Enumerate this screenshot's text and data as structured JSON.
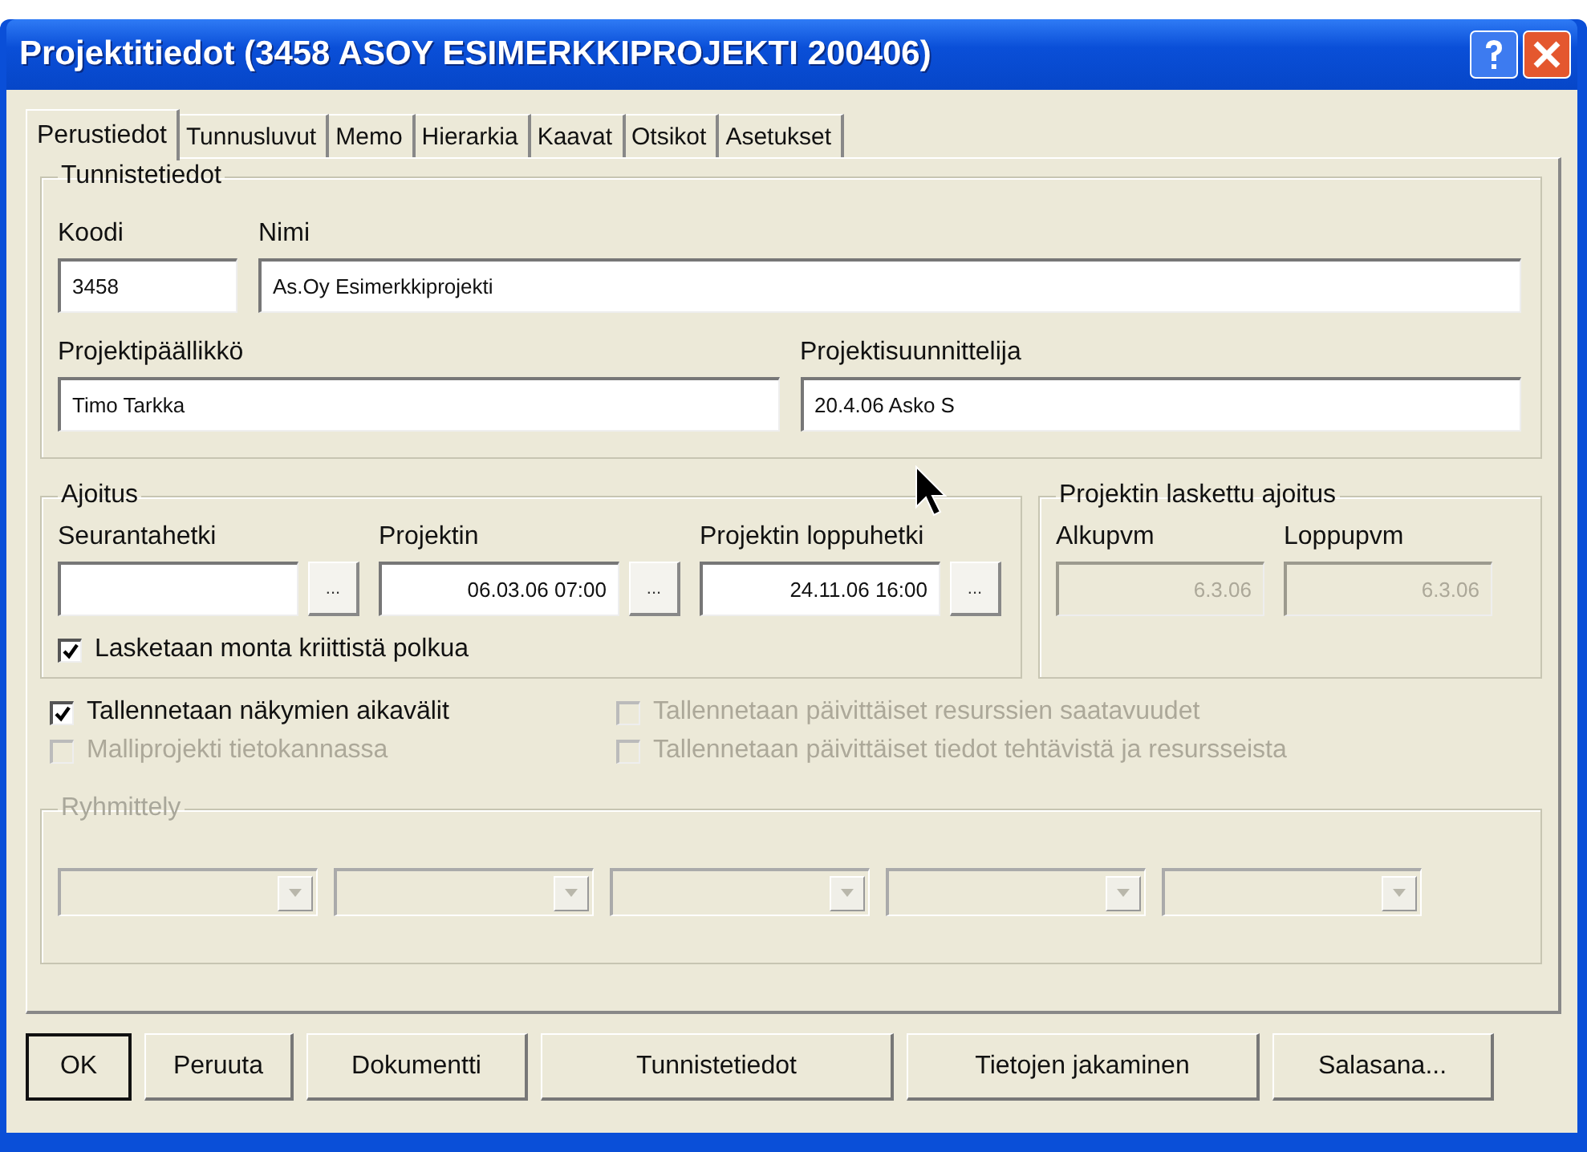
{
  "window": {
    "title": "Projektitiedot (3458 ASOY ESIMERKKIPROJEKTI 200406)"
  },
  "tabs": [
    {
      "label": "Perustiedot",
      "selected": true
    },
    {
      "label": "Tunnusluvut",
      "selected": false
    },
    {
      "label": "Memo",
      "selected": false
    },
    {
      "label": "Hierarkia",
      "selected": false
    },
    {
      "label": "Kaavat",
      "selected": false
    },
    {
      "label": "Otsikot",
      "selected": false
    },
    {
      "label": "Asetukset",
      "selected": false
    }
  ],
  "identification": {
    "legend": "Tunnistetiedot",
    "fields": [
      {
        "label": "Koodi",
        "value": "3458"
      },
      {
        "label": "Nimi",
        "value": "As.Oy Esimerkkiprojekti"
      },
      {
        "label": "Projektipäällikkö",
        "value": "Timo Tarkka"
      },
      {
        "label": "Projektisuunnittelija",
        "value": "20.4.06 Asko S"
      }
    ]
  },
  "scheduling": {
    "legend": "Ajoitus",
    "fields": [
      {
        "label": "Seurantahetki",
        "picker": "..."
      },
      {
        "label": "Projektin",
        "value": "06.03.06 07:00",
        "picker": "..."
      },
      {
        "label": "Projektin loppuhetki",
        "value": "24.11.06 16:00",
        "picker": "..."
      }
    ],
    "checkbox": {
      "label": "Lasketaan monta kriittistä polkua",
      "checked": true,
      "disabled": false
    }
  },
  "calculated": {
    "legend": "Projektin laskettu ajoitus",
    "fields": [
      {
        "label": "Alkupvm",
        "value": "6.3.06",
        "disabled": true
      },
      {
        "label": "Loppupvm",
        "value": "6.3.06",
        "disabled": true
      }
    ]
  },
  "options": [
    {
      "label": "Tallennetaan näkymien aikavälit",
      "checked": true,
      "disabled": false
    },
    {
      "label": "Tallennetaan päivittäiset resurssien saatavuudet",
      "checked": false,
      "disabled": true
    },
    {
      "label": "Malliprojekti tietokannassa",
      "checked": false,
      "disabled": true
    },
    {
      "label": "Tallennetaan päivittäiset tiedot tehtävistä ja resursseista",
      "checked": false,
      "disabled": true
    }
  ],
  "grouping": {
    "legend": "Ryhmittely",
    "disabled": true,
    "dropdowns": [
      {
        "disabled": true
      },
      {
        "disabled": true
      },
      {
        "disabled": true
      },
      {
        "disabled": true
      },
      {
        "disabled": true
      }
    ]
  },
  "buttons": [
    {
      "label": "OK",
      "default": true
    },
    {
      "label": "Peruuta",
      "default": false
    },
    {
      "label": "Dokumentti",
      "default": false
    },
    {
      "label": "Tunnistetiedot",
      "default": false
    },
    {
      "label": "Tietojen jakaminen",
      "default": false
    },
    {
      "label": "Salasana...",
      "default": false
    }
  ]
}
